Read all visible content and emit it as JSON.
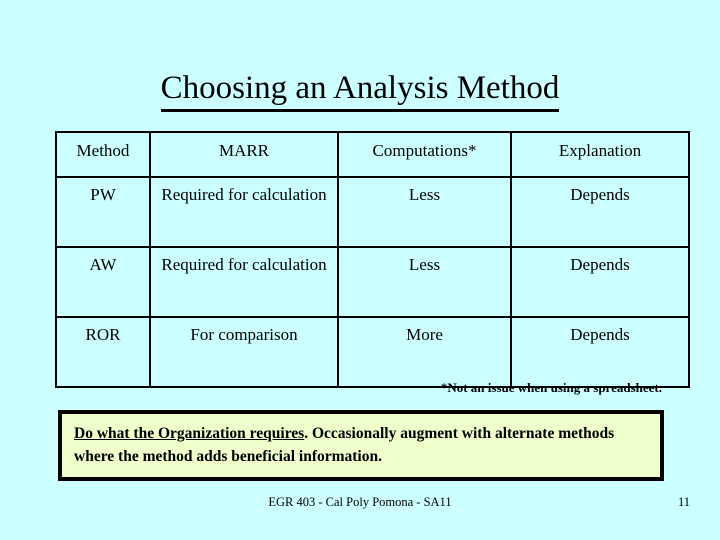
{
  "slide": {
    "background_color": "#CCFFFF",
    "title": "Choosing an Analysis Method"
  },
  "table": {
    "columns": [
      "Method",
      "MARR",
      "Computations*",
      "Explanation"
    ],
    "rows": [
      {
        "method": "PW",
        "marr": "Required for calculation",
        "computations": "Less",
        "explanation": "Depends"
      },
      {
        "method": "AW",
        "marr": "Required for calculation",
        "computations": "Less",
        "explanation": "Depends"
      },
      {
        "method": "ROR",
        "marr": "For comparison",
        "computations": "More",
        "explanation": "Depends"
      }
    ]
  },
  "footnote": "*Not an issue when using a spreadsheet.",
  "callout": {
    "background_color": "#EEFFCC",
    "border_color": "#000000",
    "emphasis": "Do what the Organization requires",
    "rest": ".  Occasionally augment with alternate methods where the method adds beneficial information."
  },
  "footer": {
    "course": "EGR 403 - Cal Poly Pomona - SA11",
    "page_number": "11"
  }
}
